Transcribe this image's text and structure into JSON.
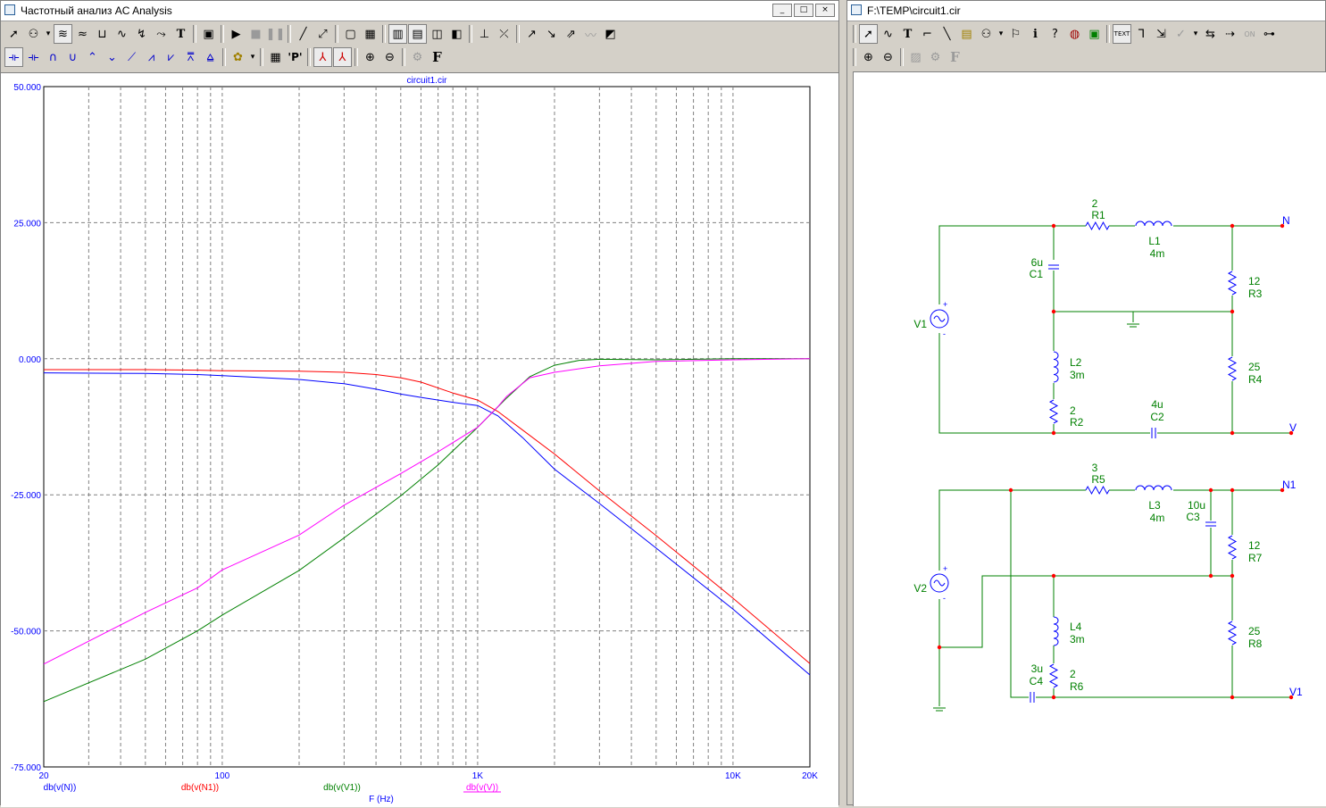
{
  "left_window": {
    "title": "Частотный анализ AC Analysis",
    "controls": [
      "_",
      "□",
      "×"
    ],
    "toolbar1_icons": [
      "select-arrow-icon",
      "component-icon",
      "dropdown-arrow-icon",
      "wave1-icon",
      "wave2-icon",
      "wave3-icon",
      "wave4-icon",
      "wave5-icon",
      "wave6-icon",
      "text-icon",
      "properties-icon",
      "run-icon",
      "stop-icon",
      "pause-icon",
      "line-icon",
      "diag-line-icon",
      "frame-icon",
      "grid-icon",
      "grid2-icon",
      "grid3-icon",
      "grid4-icon",
      "grid5-icon",
      "axis-icon",
      "cursor-icon",
      "tool1-icon",
      "tool2-icon",
      "tool3-icon",
      "tool4-icon",
      "tool5-icon"
    ],
    "toolbar2_icons": [
      "cursor-left-icon",
      "cursor-right-icon",
      "peak-icon",
      "valley-icon",
      "high-icon",
      "low-icon",
      "slope-icon",
      "next-peak-icon",
      "next-valley-icon",
      "global-high-icon",
      "global-low-icon",
      "palette-icon",
      "table-icon",
      "p-icon",
      "tag-icon",
      "tag2-icon",
      "zoom-in-icon",
      "zoom-out-icon",
      "gear-icon",
      "font-icon"
    ],
    "text_labels": {
      "text_tool": "T",
      "p_tool": "'P'",
      "font_tool": "F"
    }
  },
  "right_window": {
    "title": "F:\\TEMP\\circuit1.cir",
    "text_labels": {
      "text_tool": "T",
      "info_tool": "i",
      "font_tool": "F",
      "text_badge": "TEXT",
      "on_badge": "ON"
    }
  },
  "colors": {
    "blue": "#0000ff",
    "red": "#ff0000",
    "green": "#008000",
    "magenta": "#ff00ff",
    "wire": "#008000",
    "component": "#0000ff",
    "node": "#ff0000"
  },
  "chart_data": {
    "type": "line",
    "title": "circuit1.cir",
    "xlabel": "F (Hz)",
    "ylabel": "",
    "xscale": "log",
    "xlim": [
      20,
      20000
    ],
    "ylim": [
      -75,
      50
    ],
    "grid": true,
    "y_ticks": [
      "50.000",
      "25.000",
      "0.000",
      "-25.000",
      "-50.000",
      "-75.000"
    ],
    "y_tick_values": [
      50,
      25,
      0,
      -25,
      -50,
      -75
    ],
    "x_tick_labels": [
      "20",
      "100",
      "1K",
      "10K",
      "20K"
    ],
    "x_tick_values": [
      20,
      100,
      1000,
      10000,
      20000
    ],
    "series": [
      {
        "name": "db(v(N))",
        "color": "#0000ff",
        "x": [
          20,
          50,
          80,
          100,
          200,
          300,
          400,
          500,
          600,
          800,
          1000,
          1200,
          1500,
          2000,
          3000,
          5000,
          10000,
          20000
        ],
        "y": [
          -2.6,
          -2.7,
          -2.9,
          -3.1,
          -3.8,
          -4.6,
          -5.6,
          -6.5,
          -7.1,
          -8.0,
          -8.6,
          -10.5,
          -14.5,
          -20.3,
          -26.6,
          -34.8,
          -46.0,
          -58.1
        ]
      },
      {
        "name": "db(v(N1))",
        "color": "#ff0000",
        "x": [
          20,
          50,
          80,
          100,
          200,
          300,
          400,
          500,
          600,
          800,
          1000,
          1200,
          1500,
          2000,
          3000,
          5000,
          10000,
          20000
        ],
        "y": [
          -2.0,
          -2.0,
          -2.1,
          -2.2,
          -2.3,
          -2.5,
          -2.9,
          -3.5,
          -4.3,
          -6.3,
          -7.6,
          -9.7,
          -13.1,
          -17.5,
          -24.3,
          -32.5,
          -44.0,
          -56.0
        ]
      },
      {
        "name": "db(v(V1))",
        "color": "#008000",
        "x": [
          20,
          50,
          80,
          100,
          200,
          300,
          500,
          700,
          1000,
          1300,
          1600,
          2000,
          2500,
          3000,
          5000,
          10000,
          20000
        ],
        "y": [
          -63.0,
          -55.2,
          -50.0,
          -47.1,
          -38.9,
          -32.9,
          -25.2,
          -19.5,
          -12.6,
          -7.2,
          -3.3,
          -1.2,
          -0.3,
          -0.1,
          -0.2,
          0.0,
          0.0
        ]
      },
      {
        "name": "db(v(V))",
        "color": "#ff00ff",
        "x": [
          20,
          50,
          80,
          100,
          200,
          300,
          500,
          700,
          1000,
          1200,
          1300,
          1600,
          2000,
          3000,
          5000,
          10000,
          20000
        ],
        "y": [
          -56.1,
          -46.6,
          -42.1,
          -38.8,
          -32.4,
          -26.9,
          -21.1,
          -17.1,
          -12.6,
          -8.8,
          -6.9,
          -3.5,
          -2.5,
          -1.3,
          -0.5,
          -0.2,
          0.0
        ]
      }
    ]
  },
  "schematic": {
    "components": [
      {
        "id": "R1",
        "value": "2"
      },
      {
        "id": "L1",
        "value": "4m"
      },
      {
        "id": "C1",
        "value": "6u"
      },
      {
        "id": "R3",
        "value": "12"
      },
      {
        "id": "L2",
        "value": "3m"
      },
      {
        "id": "R4",
        "value": "25"
      },
      {
        "id": "R2",
        "value": "2"
      },
      {
        "id": "C2",
        "value": "4u"
      },
      {
        "id": "V1",
        "value": ""
      },
      {
        "id": "R5",
        "value": "3"
      },
      {
        "id": "L3",
        "value": "4m"
      },
      {
        "id": "C3",
        "value": "10u"
      },
      {
        "id": "R7",
        "value": "12"
      },
      {
        "id": "L4",
        "value": "3m"
      },
      {
        "id": "R8",
        "value": "25"
      },
      {
        "id": "C4",
        "value": "3u"
      },
      {
        "id": "R6",
        "value": "2"
      },
      {
        "id": "V2",
        "value": ""
      }
    ],
    "nodes": {
      "n_top": "N",
      "v_top": "V",
      "n_bottom": "N1",
      "v_bottom": "V1"
    },
    "source_sign_plus": "+",
    "source_sign_minus": "-"
  }
}
